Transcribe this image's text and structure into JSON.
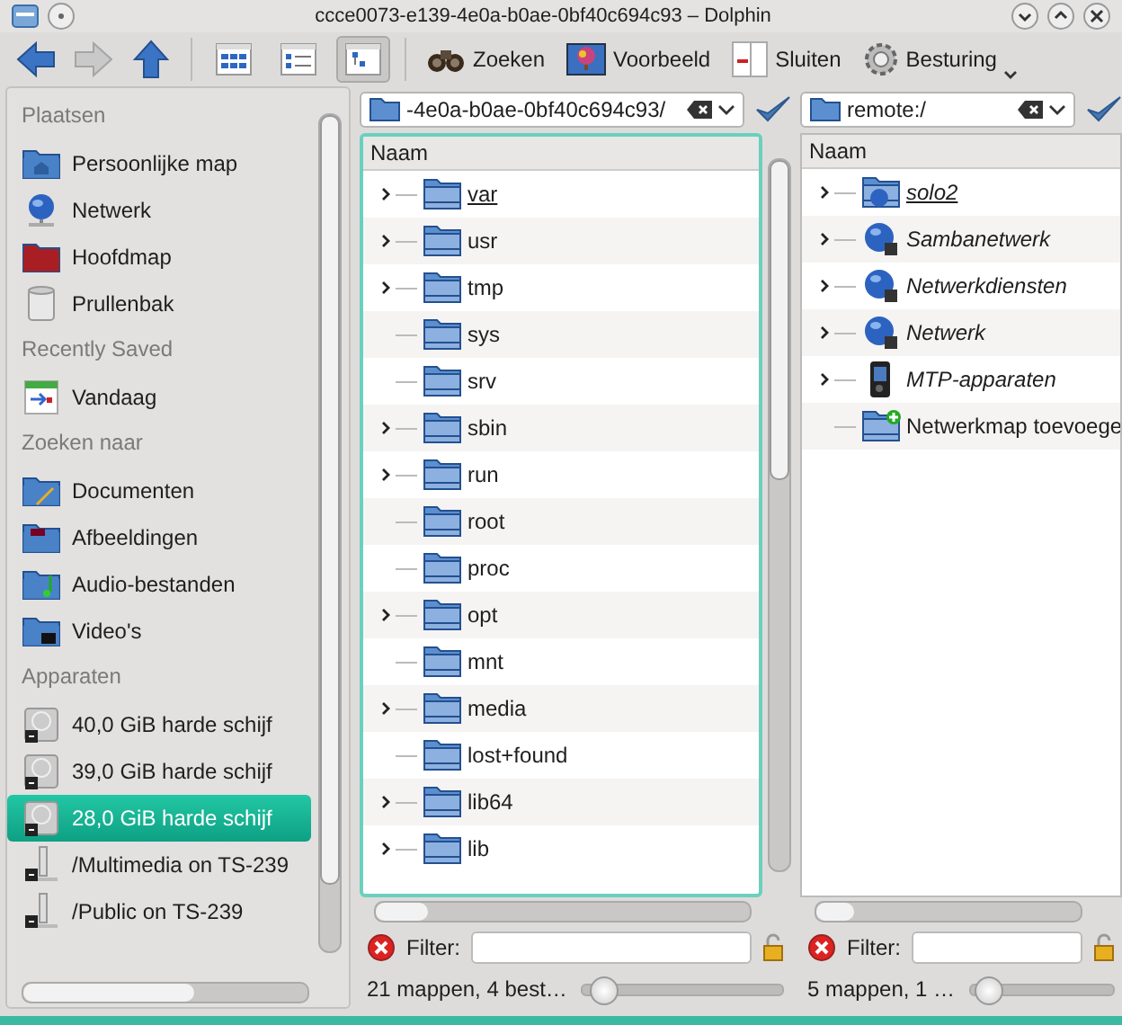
{
  "window": {
    "title": "ccce0073-e139-4e0a-b0ae-0bf40c694c93 – Dolphin"
  },
  "toolbar": {
    "view_modes": [
      {
        "selected": false
      },
      {
        "selected": false
      },
      {
        "selected": true
      }
    ],
    "actions": [
      {
        "label": "Zoeken",
        "kind": "search"
      },
      {
        "label": "Voorbeeld",
        "kind": "preview"
      },
      {
        "label": "Sluiten",
        "kind": "split"
      },
      {
        "label": "Besturing",
        "kind": "control"
      }
    ]
  },
  "places": [
    {
      "title": "Plaatsen",
      "items": [
        {
          "label": "Persoonlijke map",
          "kind": "home",
          "selected": false
        },
        {
          "label": "Netwerk",
          "kind": "network",
          "selected": false
        },
        {
          "label": "Hoofdmap",
          "kind": "root",
          "selected": false
        },
        {
          "label": "Prullenbak",
          "kind": "trash",
          "selected": false
        }
      ]
    },
    {
      "title": "Recently Saved",
      "items": [
        {
          "label": "Vandaag",
          "kind": "calendar",
          "selected": false
        }
      ]
    },
    {
      "title": "Zoeken naar",
      "items": [
        {
          "label": "Documenten",
          "kind": "documents",
          "selected": false
        },
        {
          "label": "Afbeeldingen",
          "kind": "pictures",
          "selected": false
        },
        {
          "label": "Audio-bestanden",
          "kind": "audio",
          "selected": false
        },
        {
          "label": "Video's",
          "kind": "video",
          "selected": false
        }
      ]
    },
    {
      "title": "Apparaten",
      "items": [
        {
          "label": "40,0 GiB harde schijf",
          "kind": "drive",
          "selected": false
        },
        {
          "label": "39,0 GiB harde schijf",
          "kind": "drive",
          "selected": false
        },
        {
          "label": "28,0 GiB harde schijf",
          "kind": "drive",
          "selected": true
        },
        {
          "label": "/Multimedia on TS-239",
          "kind": "share",
          "selected": false
        },
        {
          "label": "/Public on TS-239",
          "kind": "share",
          "selected": false
        }
      ]
    }
  ],
  "panes": [
    {
      "location": "-4e0a-b0ae-0bf40c694c93/",
      "active": true,
      "column": "Naam",
      "filter_label": "Filter:",
      "status": "21 mappen, 4 best…",
      "zoom": {
        "level": 0.05
      },
      "rows": [
        {
          "name": "var",
          "kind": "folder",
          "expandable": true,
          "current": true
        },
        {
          "name": "usr",
          "kind": "folder",
          "expandable": true,
          "current": false
        },
        {
          "name": "tmp",
          "kind": "folder",
          "expandable": true,
          "current": false
        },
        {
          "name": "sys",
          "kind": "folder",
          "expandable": false,
          "current": false
        },
        {
          "name": "srv",
          "kind": "folder",
          "expandable": false,
          "current": false
        },
        {
          "name": "sbin",
          "kind": "folder",
          "expandable": true,
          "current": false
        },
        {
          "name": "run",
          "kind": "folder",
          "expandable": true,
          "current": false
        },
        {
          "name": "root",
          "kind": "folder",
          "expandable": false,
          "current": false
        },
        {
          "name": "proc",
          "kind": "folder",
          "expandable": false,
          "current": false
        },
        {
          "name": "opt",
          "kind": "folder",
          "expandable": true,
          "current": false
        },
        {
          "name": "mnt",
          "kind": "folder",
          "expandable": false,
          "current": false
        },
        {
          "name": "media",
          "kind": "folder",
          "expandable": true,
          "current": false
        },
        {
          "name": "lost+found",
          "kind": "folder",
          "expandable": false,
          "current": false
        },
        {
          "name": "lib64",
          "kind": "folder",
          "expandable": true,
          "current": false
        },
        {
          "name": "lib",
          "kind": "folder",
          "expandable": true,
          "current": false
        }
      ]
    },
    {
      "location": "remote:/",
      "active": false,
      "column": "Naam",
      "filter_label": "Filter:",
      "status": "5 mappen, 1 …",
      "zoom": {
        "level": 0.05
      },
      "rows": [
        {
          "name": "solo2",
          "kind": "remote",
          "expandable": true,
          "current": true
        },
        {
          "name": "Sambanetwerk",
          "kind": "network",
          "expandable": true,
          "current": false
        },
        {
          "name": "Netwerkdiensten",
          "kind": "network",
          "expandable": true,
          "current": false
        },
        {
          "name": "Netwerk",
          "kind": "network",
          "expandable": true,
          "current": false
        },
        {
          "name": "MTP-apparaten",
          "kind": "device",
          "expandable": true,
          "current": false
        },
        {
          "name": "Netwerkmap toevoege",
          "kind": "add",
          "expandable": false,
          "current": false
        }
      ]
    }
  ]
}
